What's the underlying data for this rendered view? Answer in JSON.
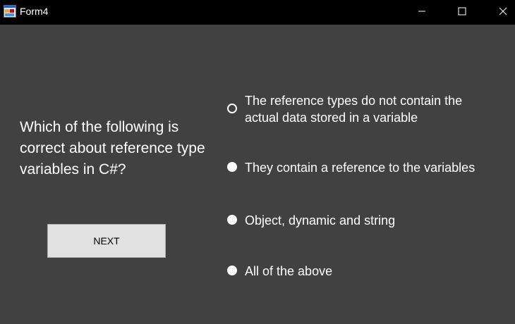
{
  "window": {
    "title": "Form4",
    "icon": "form-app-icon",
    "controls": [
      "minimize-icon",
      "maximize-icon",
      "close-icon"
    ]
  },
  "quiz": {
    "question": "Which of the following is correct about reference type variables in C#?",
    "next_label": "NEXT",
    "options": [
      {
        "line1": "The reference types do not contain the",
        "line2": "actual data stored in a variable",
        "selected": true
      },
      {
        "label": "They contain a reference to the variables",
        "selected": false
      },
      {
        "label": "Object, dynamic and string",
        "selected": false
      },
      {
        "label": "All of the above",
        "selected": false
      }
    ]
  },
  "colors": {
    "background": "#414141",
    "titlebar": "#000000",
    "text": "#ffffff",
    "button": "#e1e1e1"
  }
}
